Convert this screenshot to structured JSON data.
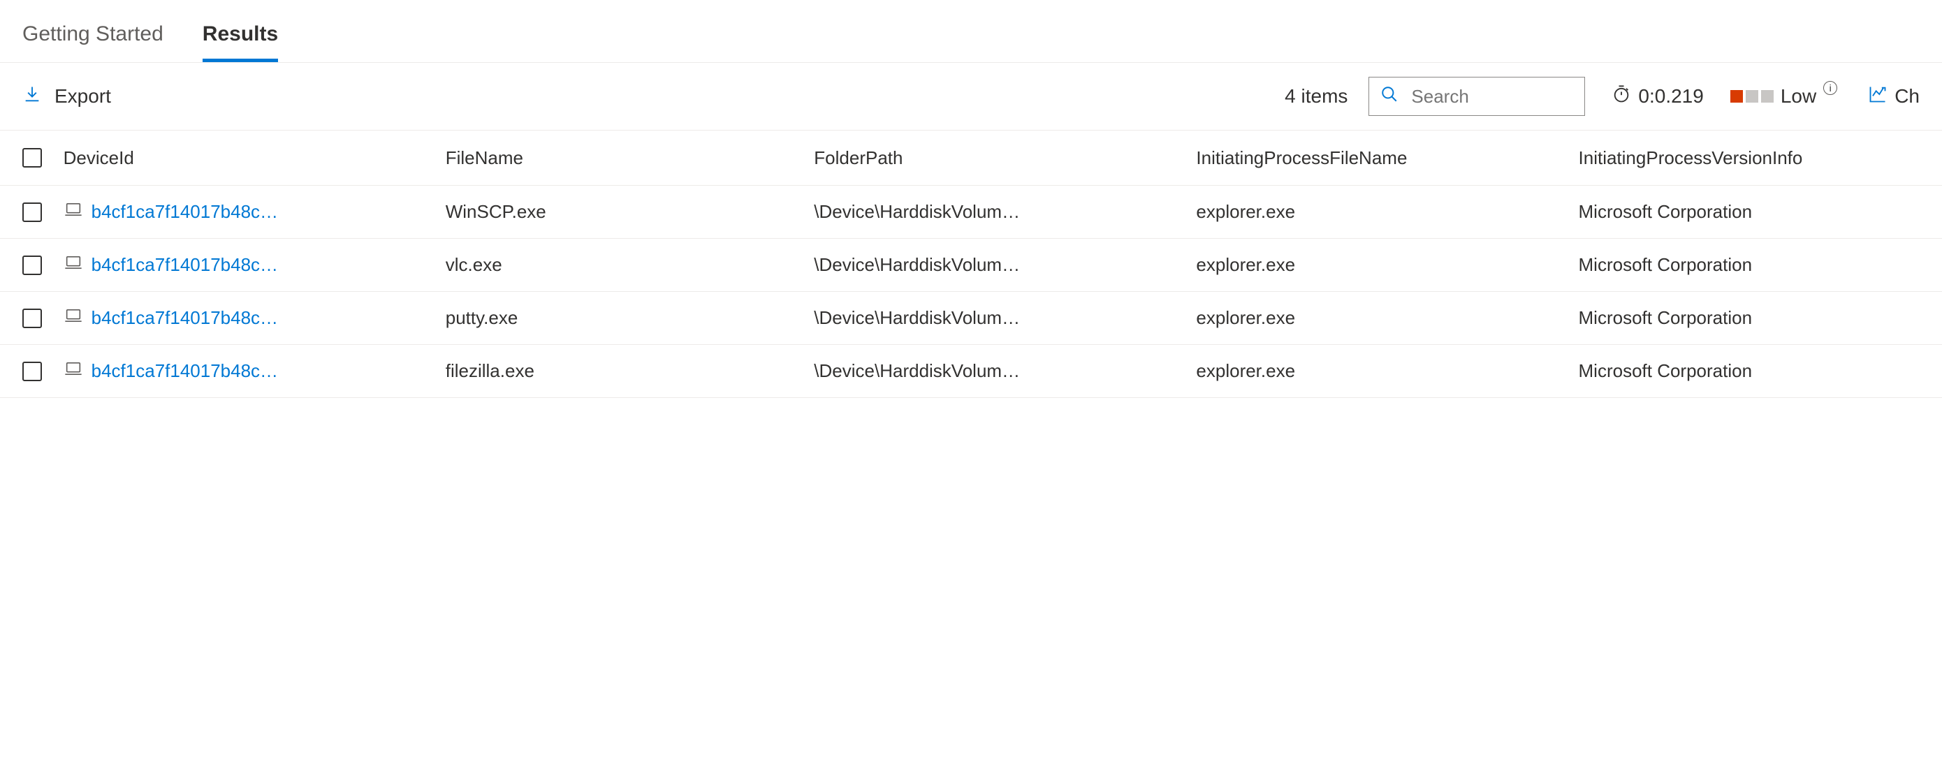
{
  "tabs": {
    "getting_started": "Getting Started",
    "results": "Results"
  },
  "toolbar": {
    "export_label": "Export",
    "item_count": "4 items",
    "search_placeholder": "Search",
    "time_label": "0:0.219",
    "usage_label": "Low",
    "chart_label": "Ch"
  },
  "table": {
    "headers": {
      "device_id": "DeviceId",
      "file_name": "FileName",
      "folder_path": "FolderPath",
      "init_proc_file": "InitiatingProcessFileName",
      "init_proc_ver": "InitiatingProcessVersionInfo"
    },
    "rows": [
      {
        "device_id": "b4cf1ca7f14017b48c…",
        "file_name": "WinSCP.exe",
        "folder_path": "\\Device\\HarddiskVolum…",
        "init_proc_file": "explorer.exe",
        "init_proc_ver": "Microsoft Corporation"
      },
      {
        "device_id": "b4cf1ca7f14017b48c…",
        "file_name": "vlc.exe",
        "folder_path": "\\Device\\HarddiskVolum…",
        "init_proc_file": "explorer.exe",
        "init_proc_ver": "Microsoft Corporation"
      },
      {
        "device_id": "b4cf1ca7f14017b48c…",
        "file_name": "putty.exe",
        "folder_path": "\\Device\\HarddiskVolum…",
        "init_proc_file": "explorer.exe",
        "init_proc_ver": "Microsoft Corporation"
      },
      {
        "device_id": "b4cf1ca7f14017b48c…",
        "file_name": "filezilla.exe",
        "folder_path": "\\Device\\HarddiskVolum…",
        "init_proc_file": "explorer.exe",
        "init_proc_ver": "Microsoft Corporation"
      }
    ]
  }
}
